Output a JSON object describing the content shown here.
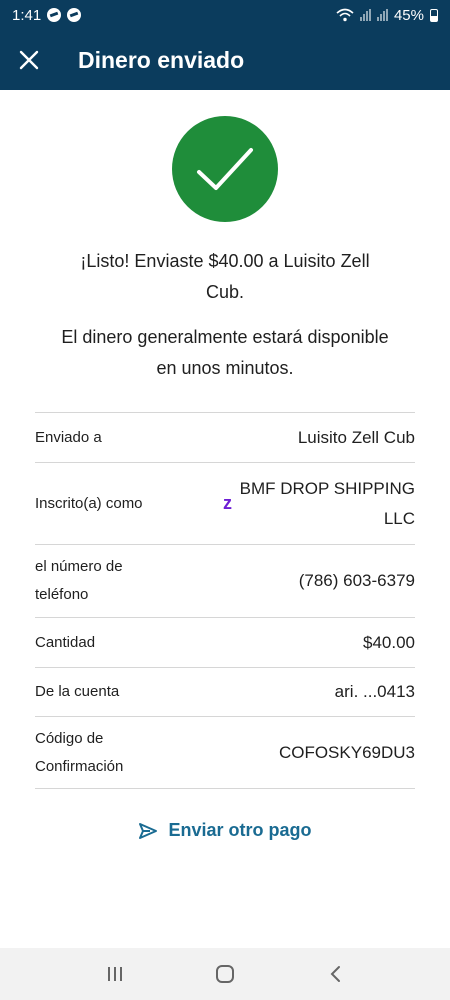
{
  "status_bar": {
    "time": "1:41",
    "battery": "45%"
  },
  "header": {
    "title": "Dinero enviado",
    "close_icon": "close-icon"
  },
  "success_icon": "check-circle-icon",
  "message": {
    "line1": "¡Listo! Enviaste $40.00 a Luisito Zell Cub.",
    "line2": "El dinero generalmente estará disponible en unos minutos."
  },
  "details": {
    "sent_to": {
      "label": "Enviado a",
      "value": "Luisito Zell Cub"
    },
    "enrolled_as": {
      "label": "Inscrito(a) como",
      "value": "BMF DROP SHIPPING LLC",
      "mark": "z"
    },
    "phone": {
      "label": "el número de teléfono",
      "value": "(786) 603-6379"
    },
    "amount": {
      "label": "Cantidad",
      "value": "$40.00"
    },
    "from_account": {
      "label": "De la cuenta",
      "value": "ari. ...0413"
    },
    "confirmation": {
      "label": "Código de Confirmación",
      "value": "COFOSKY69DU3"
    }
  },
  "actions": {
    "send_another": "Enviar otro pago",
    "send_icon": "send-icon"
  },
  "colors": {
    "header_bg": "#0b3c5d",
    "success_green": "#1f8d3a",
    "link_blue": "#1a6b92",
    "zelle_purple": "#6d1ed4"
  },
  "nav": {
    "recents_icon": "recent-apps-icon",
    "home_icon": "home-icon",
    "back_icon": "back-icon"
  }
}
